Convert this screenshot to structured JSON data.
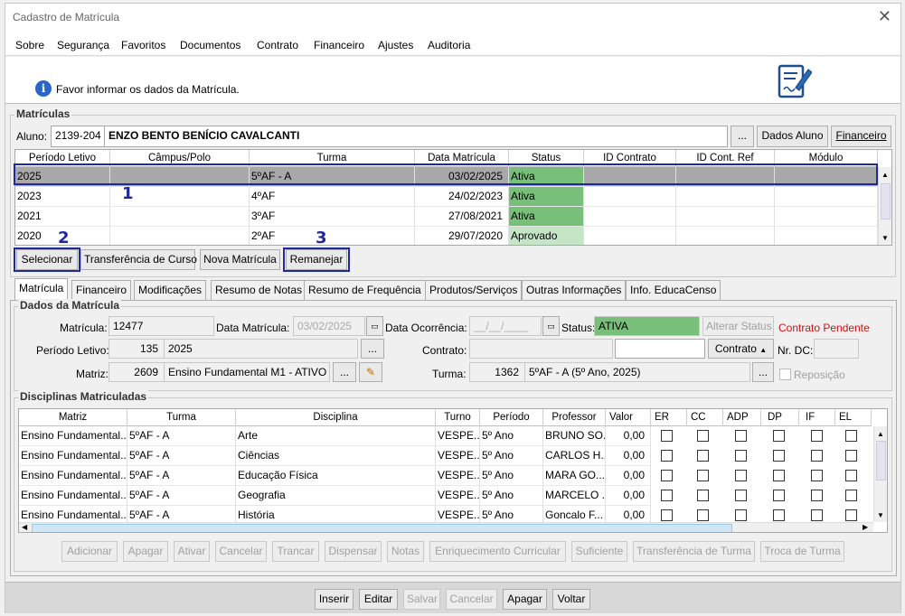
{
  "window": {
    "title": "Cadastro de Matrícula"
  },
  "menu": [
    "Sobre",
    "Segurança",
    "Favoritos",
    "Documentos",
    "Contrato",
    "Financeiro",
    "Ajustes",
    "Auditoria"
  ],
  "info": {
    "text": "Favor informar os dados da Matrícula."
  },
  "matriculas": {
    "group_title": "Matrículas",
    "aluno_label": "Aluno:",
    "aluno_code": "2139-204",
    "aluno_name": "ENZO BENTO BENÍCIO CAVALCANTI",
    "ellipsis": "...",
    "dados_aluno": "Dados Aluno",
    "financeiro": "Financeiro",
    "columns": [
      "Período Letivo",
      "Câmpus/Polo",
      "Turma",
      "Data Matrícula",
      "Status",
      "ID Contrato",
      "ID Cont. Ref",
      "Módulo"
    ],
    "rows": [
      {
        "periodo": "2025",
        "campus": "",
        "turma": "5ºAF - A",
        "data": "03/02/2025",
        "status": "Ativa"
      },
      {
        "periodo": "2023",
        "campus": "",
        "turma": "4ºAF",
        "data": "24/02/2023",
        "status": "Ativa"
      },
      {
        "periodo": "2021",
        "campus": "",
        "turma": "3ºAF",
        "data": "27/08/2021",
        "status": "Ativa"
      },
      {
        "periodo": "2020",
        "campus": "",
        "turma": "2ºAF",
        "data": "29/07/2020",
        "status": "Aprovado"
      }
    ],
    "buttons": [
      "Selecionar",
      "Transferência de Curso",
      "Nova Matrícula",
      "Remanejar"
    ]
  },
  "annotations": [
    "1",
    "2",
    "3"
  ],
  "tabs": [
    "Matrícula",
    "Financeiro",
    "Modificações",
    "Resumo de Notas",
    "Resumo de Frequência",
    "Produtos/Serviços",
    "Outras Informações",
    "Info. EducaCenso"
  ],
  "dados": {
    "group_title": "Dados da Matrícula",
    "matricula_label": "Matrícula:",
    "matricula": "12477",
    "data_label": "Data Matrícula:",
    "data": "03/02/2025",
    "ocorrencia_label": "Data Ocorrência:",
    "ocorrencia": "__/__/____",
    "status_label": "Status:",
    "status": "ATIVA",
    "alterar_status": "Alterar Status",
    "contrato_pendente": "Contrato Pendente",
    "periodo_label": "Período Letivo:",
    "periodo_code": "135",
    "periodo_value": "2025",
    "contrato_label": "Contrato:",
    "contrato_btn": "Contrato",
    "nrdc_label": "Nr. DC:",
    "matriz_label": "Matriz:",
    "matriz_code": "2609",
    "matriz_value": "Ensino Fundamental M1 - ATIVO",
    "turma_label": "Turma:",
    "turma_code": "1362",
    "turma_value": "5ºAF - A (5º Ano, 2025)",
    "reposicao": "Reposição"
  },
  "disciplinas": {
    "group_title": "Disciplinas Matriculadas",
    "columns": [
      "Matriz",
      "Turma",
      "Disciplina",
      "Turno",
      "Período",
      "Professor",
      "Valor",
      "ER",
      "CC",
      "ADP",
      "DP",
      "IF",
      "EL"
    ],
    "rows": [
      {
        "matriz": "Ensino Fundamental...",
        "turma": "5ºAF - A",
        "disciplina": "Arte",
        "turno": "VESPE...",
        "periodo": "5º Ano",
        "professor": "BRUNO SO...",
        "valor": "0,00"
      },
      {
        "matriz": "Ensino Fundamental...",
        "turma": "5ºAF - A",
        "disciplina": "Ciências",
        "turno": "VESPE...",
        "periodo": "5º Ano",
        "professor": "CARLOS H...",
        "valor": "0,00"
      },
      {
        "matriz": "Ensino Fundamental...",
        "turma": "5ºAF - A",
        "disciplina": "Educação Física",
        "turno": "VESPE...",
        "periodo": "5º Ano",
        "professor": "MARA GO...",
        "valor": "0,00"
      },
      {
        "matriz": "Ensino Fundamental...",
        "turma": "5ºAF - A",
        "disciplina": "Geografia",
        "turno": "VESPE...",
        "periodo": "5º Ano",
        "professor": "MARCELO ...",
        "valor": "0,00"
      },
      {
        "matriz": "Ensino Fundamental...",
        "turma": "5ºAF - A",
        "disciplina": "História",
        "turno": "VESPE...",
        "periodo": "5º Ano",
        "professor": "Goncalo F...",
        "valor": "0,00"
      }
    ],
    "buttons": [
      "Adicionar",
      "Apagar",
      "Ativar",
      "Cancelar",
      "Trancar",
      "Dispensar",
      "Notas",
      "Enriquecimento Curricular",
      "Suficiente",
      "Transferência de Turma",
      "Troca de Turma"
    ]
  },
  "footer": {
    "buttons": [
      "Inserir",
      "Editar",
      "Salvar",
      "Cancelar",
      "Apagar",
      "Voltar"
    ]
  },
  "colors": {
    "status_green": "#78c07a",
    "status_light": "#c5e6c6",
    "annotation": "#1f2a9a",
    "pending_red": "#d01010"
  }
}
